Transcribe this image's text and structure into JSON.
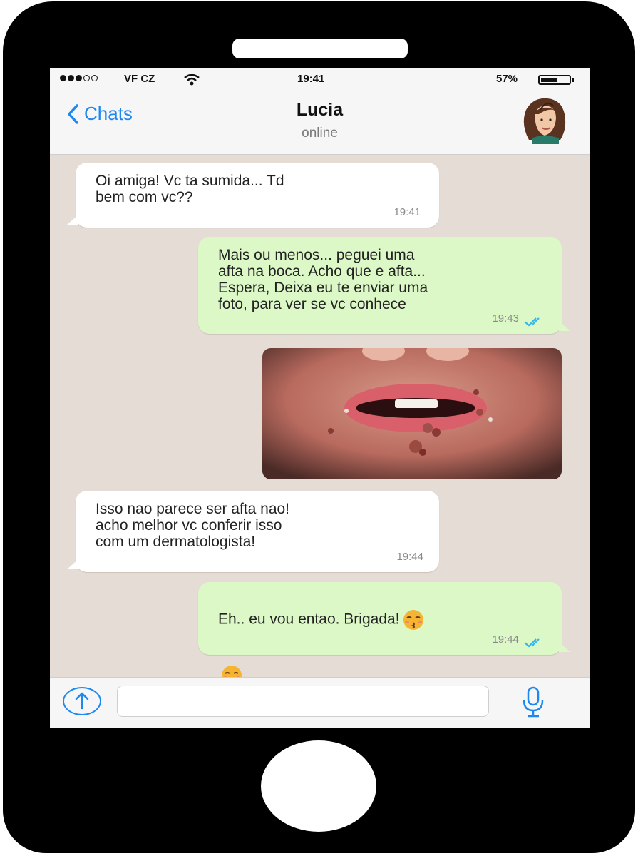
{
  "status_bar": {
    "carrier": "VF CZ",
    "time": "19:41",
    "battery": "57%",
    "battery_level": 0.57,
    "signal_bars_filled": 3,
    "signal_bars_total": 5,
    "wifi_icon": "wifi-icon"
  },
  "header": {
    "back_label": "Chats",
    "back_icon": "chevron-left-icon",
    "contact_name": "Lucia",
    "contact_status": "online",
    "accent_color": "#1e88f0"
  },
  "messages": [
    {
      "direction": "incoming",
      "text": "Oi amiga! Vc ta sumida... Td\nbem com vc??",
      "time": "19:41"
    },
    {
      "direction": "outgoing",
      "text": "Mais ou menos... peguei uma\nafta na boca. Acho que e afta...\nEspera, Deixa eu te enviar uma\nfoto, para ver se vc conhece",
      "time": "19:43",
      "read_icon": "double-check-icon"
    },
    {
      "direction": "outgoing",
      "type": "image"
    },
    {
      "direction": "incoming",
      "text": "Isso nao parece ser afta nao!\nacho melhor vc conferir isso\ncom um dermatologista!",
      "time": "19:44"
    },
    {
      "direction": "outgoing",
      "text": "Eh.. eu vou entao. Brigada!",
      "time": "19:44",
      "emoji": "kissing-face-emoji",
      "read_icon": "double-check-icon"
    }
  ],
  "composer": {
    "attach_icon": "upload-arrow-icon",
    "mic_icon": "microphone-icon",
    "input_value": ""
  },
  "colors": {
    "incoming_bubble": "#ffffff",
    "outgoing_bubble": "#dcf8c6",
    "chat_background": "#e5ddd5",
    "read_check": "#34b7f1"
  }
}
